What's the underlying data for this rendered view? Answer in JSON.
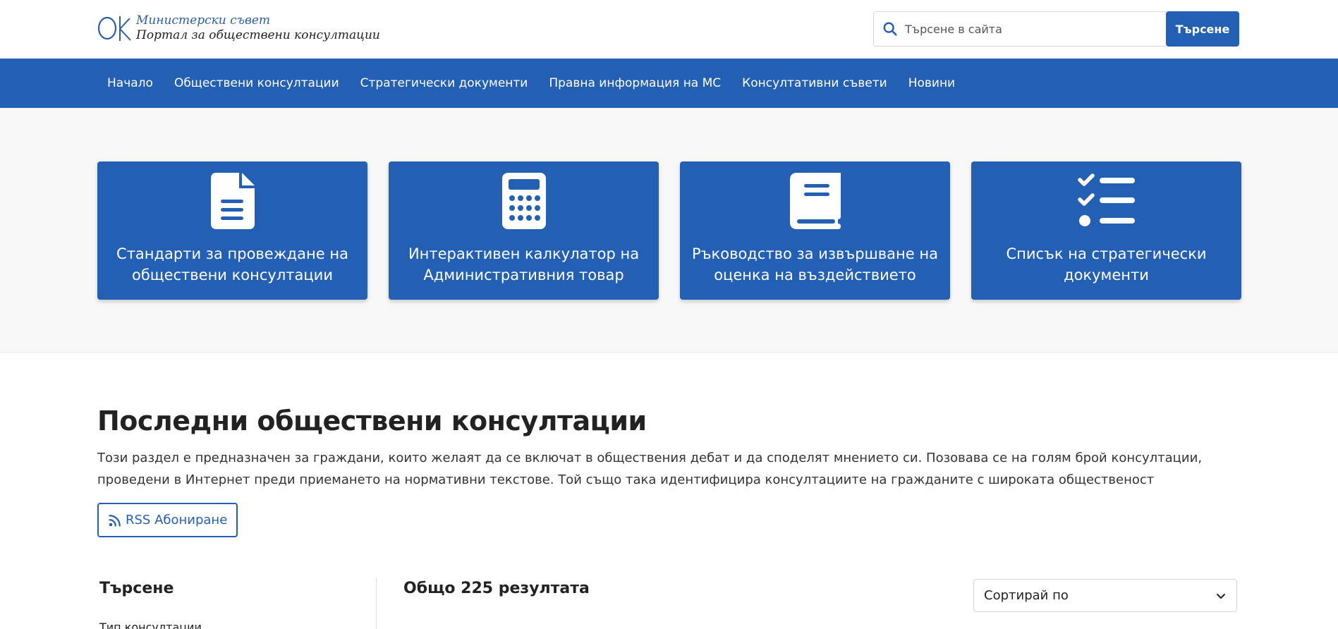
{
  "header": {
    "logo_line1": "Министерски съвет",
    "logo_line2": "Портал за обществени консултации",
    "search_placeholder": "Търсене в сайта",
    "search_button": "Търсене"
  },
  "nav": {
    "items": [
      "Начало",
      "Обществени консултации",
      "Стратегически документи",
      "Правна информация на МС",
      "Консултативни съвети",
      "Новини"
    ]
  },
  "cards": [
    {
      "label": "Стандарти за провеждане на обществени консултации",
      "icon": "file-icon"
    },
    {
      "label": "Интерактивен калкулатор на Административния товар",
      "icon": "calculator-icon"
    },
    {
      "label": "Ръководство за извършване на оценка на въздействието",
      "icon": "book-icon"
    },
    {
      "label": "Списък на стратегически документи",
      "icon": "checklist-icon"
    }
  ],
  "section": {
    "title": "Последни обществени консултации",
    "description": "Този раздел е предназначен за граждани, които желаят да се включат в обществения дебат и да споделят мнението си. Позовава се на голям брой консултации, проведени в Интернет преди приемането на нормативни текстове. Той също така идентифицира консултациите на гражданите с широката общественост",
    "rss_button": "RSS Абониране"
  },
  "filters": {
    "title": "Търсене",
    "first_field": "Тип консултации"
  },
  "results": {
    "count_text": "Общо 225 резултата",
    "sort_label": "Сортирай по"
  },
  "colors": {
    "brand_blue": "#2360b4",
    "hero_bg": "#f8f8f8"
  }
}
